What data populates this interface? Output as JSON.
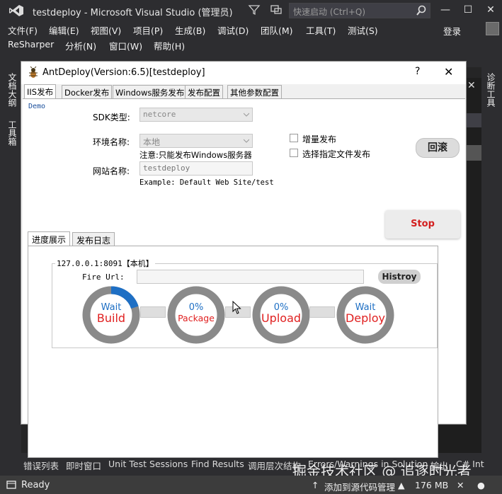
{
  "vs": {
    "title": "testdeploy - Microsoft Visual Studio (管理员)",
    "quick_launch_placeholder": "快速启动 (Ctrl+Q)",
    "login": "登录",
    "menu_row1": [
      "文件(F)",
      "编辑(E)",
      "视图(V)",
      "项目(P)",
      "生成(B)",
      "调试(D)",
      "团队(M)",
      "工具(T)",
      "测试(S)"
    ],
    "menu_row2": [
      "ReSharper",
      "分析(N)",
      "窗口(W)",
      "帮助(H)"
    ],
    "left_tabs": [
      "文档大纲",
      "工具箱"
    ],
    "right_tab": "诊断工具",
    "bottom_tabs": [
      "错误列表",
      "即时窗口",
      "Unit Test Sessions",
      "Find Results",
      "调用层次结构",
      "Errors/Warnings in Solution",
      "输出",
      "C# Int"
    ],
    "status": {
      "ready": "Ready",
      "source_control": "添加到源代码管理",
      "memory": "176 MB"
    },
    "watermark": "掘金技术社区 @ 追逐时光者"
  },
  "dialog": {
    "title": "AntDeploy(Version:6.5)[testdeploy]",
    "help": "?",
    "close": "✕",
    "tabs": [
      "IIS发布",
      "Docker发布",
      "Windows服务发布",
      "发布配置",
      "其他参数配置"
    ],
    "active_tab": "IIS发布",
    "demo": "Demo",
    "sdk_label": "SDK类型:",
    "sdk_value": "netcore",
    "env_label": "环境名称:",
    "env_value": "本地",
    "env_note": "注意:只能发布Windows服务器",
    "site_label": "网站名称:",
    "site_value": "testdeploy",
    "site_example": "Example: Default Web Site/test",
    "incremental": "增量发布",
    "select_files": "选择指定文件发布",
    "rollback": "回滚",
    "stop": "Stop",
    "subtabs": [
      "进度展示",
      "发布日志"
    ],
    "server_title": "127.0.0.1:8091【本机】",
    "fire_url_label": "Fire Url:",
    "fire_url_value": "",
    "histroy": "Histroy",
    "steps": [
      {
        "top": "Wait",
        "bottom": "Build",
        "progress": 0.2
      },
      {
        "top": "0%",
        "bottom": "Package",
        "progress": 0
      },
      {
        "top": "0%",
        "bottom": "Upload",
        "progress": 0
      },
      {
        "top": "Wait",
        "bottom": "Deploy",
        "progress": 0
      }
    ],
    "colors": {
      "ring": "#8a8a8a",
      "progress": "#1e6fc4",
      "step_label": "#e02020"
    }
  }
}
